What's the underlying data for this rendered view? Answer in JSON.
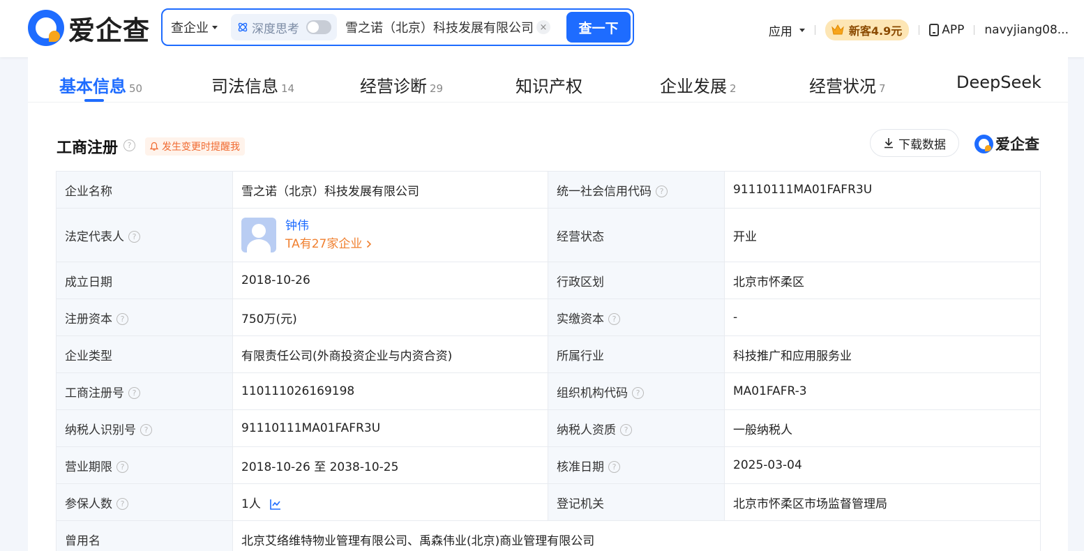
{
  "header": {
    "logo_text": "爱企查",
    "search_type": "查企业",
    "deep_think_label": "深度思考",
    "search_value": "雪之诺（北京）科技发展有限公司",
    "clear_symbol": "×",
    "search_button": "查一下",
    "apps_label": "应用",
    "promo_label": "新客4.9元",
    "app_label": "APP",
    "username": "navyjiang08..."
  },
  "tabs": [
    {
      "label": "基本信息",
      "count": "50",
      "active": true
    },
    {
      "label": "司法信息",
      "count": "14"
    },
    {
      "label": "经营诊断",
      "count": "29"
    },
    {
      "label": "知识产权",
      "count": ""
    },
    {
      "label": "企业发展",
      "count": "2"
    },
    {
      "label": "经营状况",
      "count": "7"
    },
    {
      "label": "DeepSeek",
      "count": ""
    }
  ],
  "section": {
    "title": "工商注册",
    "remind_label": "发生变更时提醒我",
    "download_label": "下载数据",
    "brand_text": "爱企查"
  },
  "info": {
    "company_name": {
      "label": "企业名称",
      "value": "雪之诺（北京）科技发展有限公司"
    },
    "credit_code": {
      "label": "统一社会信用代码",
      "value": "91110111MA01FAFR3U"
    },
    "legal_rep": {
      "label": "法定代表人",
      "name": "钟伟",
      "companies": "TA有27家企业"
    },
    "status": {
      "label": "经营状态",
      "value": "开业"
    },
    "founded": {
      "label": "成立日期",
      "value": "2018-10-26"
    },
    "region": {
      "label": "行政区划",
      "value": "北京市怀柔区"
    },
    "reg_capital": {
      "label": "注册资本",
      "value": "750万(元)"
    },
    "paid_capital": {
      "label": "实缴资本",
      "value": "-"
    },
    "company_type": {
      "label": "企业类型",
      "value": "有限责任公司(外商投资企业与内资合资)"
    },
    "industry": {
      "label": "所属行业",
      "value": "科技推广和应用服务业"
    },
    "reg_no": {
      "label": "工商注册号",
      "value": "110111026169198"
    },
    "org_code": {
      "label": "组织机构代码",
      "value": "MA01FAFR-3"
    },
    "taxpayer_id": {
      "label": "纳税人识别号",
      "value": "91110111MA01FAFR3U"
    },
    "taxpayer_qual": {
      "label": "纳税人资质",
      "value": "一般纳税人"
    },
    "term": {
      "label": "营业期限",
      "value": "2018-10-26 至 2038-10-25"
    },
    "approved": {
      "label": "核准日期",
      "value": "2025-03-04"
    },
    "insured": {
      "label": "参保人数",
      "value": "1人"
    },
    "authority": {
      "label": "登记机关",
      "value": "北京市怀柔区市场监督管理局"
    },
    "former_name": {
      "label": "曾用名",
      "value": "北京艾络维特物业管理有限公司、禹森伟业(北京)商业管理有限公司"
    }
  },
  "colors": {
    "accent": "#1e6cff",
    "warn": "#f08030",
    "promo_bg": "#fde6b5"
  }
}
